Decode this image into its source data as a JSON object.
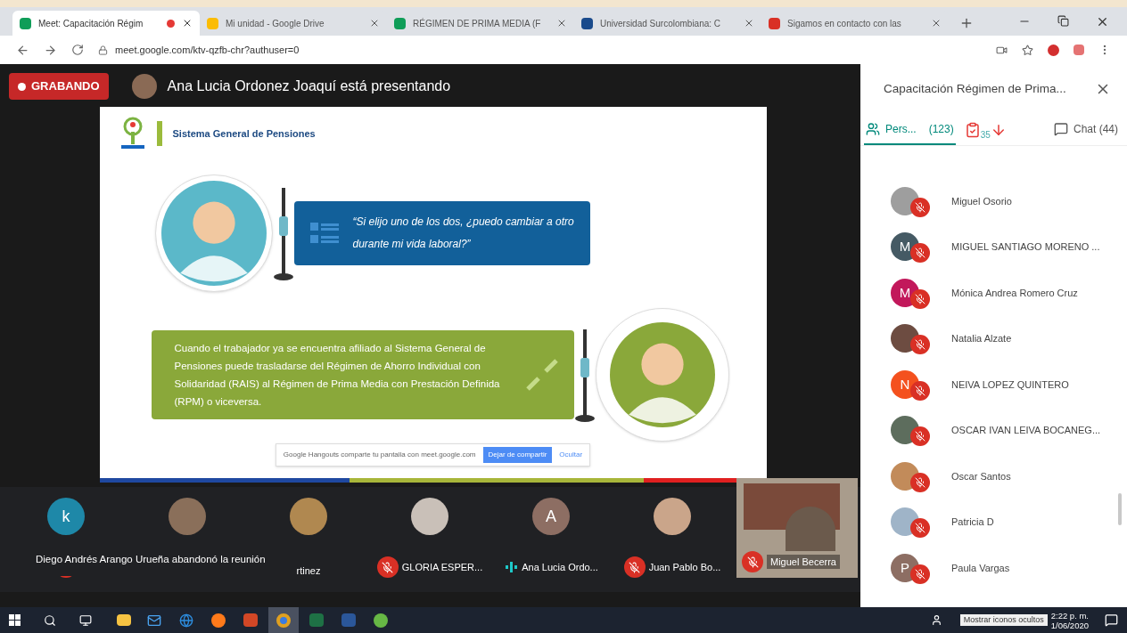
{
  "browser": {
    "tabs": [
      {
        "title": "Meet: Capacitación Régim",
        "selected": true,
        "color": "#0f9d58",
        "recording": true
      },
      {
        "title": "Mi unidad - Google Drive",
        "selected": false,
        "color": "#fbbc04",
        "recording": false
      },
      {
        "title": "RÉGIMEN DE PRIMA MEDIA (F",
        "selected": false,
        "color": "#0f9d58",
        "recording": false
      },
      {
        "title": "Universidad Surcolombiana: C",
        "selected": false,
        "color": "#1a4b8c",
        "recording": false
      },
      {
        "title": "Sigamos en contacto con las",
        "selected": false,
        "color": "#d93025",
        "recording": false
      }
    ],
    "address": "meet.google.com/ktv-qzfb-chr?authuser=0"
  },
  "meeting": {
    "recording_label": "GRABANDO",
    "presenter_text": "Ana Lucia Ordonez Joaquí está presentando"
  },
  "slide": {
    "title": "Sistema General de Pensiones",
    "question": "“Si elijo uno de los dos, ¿puedo cambiar a  otro durante mi vida laboral?”",
    "answer": "Cuando el trabajador ya se encuentra afiliado al Sistema General de Pensiones puede trasladarse del Régimen de Ahorro Individual con Solidaridad (RAIS) al Régimen de Prima Media con Prestación Definida (RPM) o viceversa.",
    "share_bar": {
      "text": "Google Hangouts comparte tu pantalla con meet.google.com",
      "stop_button": "Dejar de compartir",
      "hide_link": "Ocultar"
    }
  },
  "strip": {
    "toast": "Diego Andrés Arango Urueña abandonó la reunión",
    "tiles": [
      {
        "kind": "letter",
        "initial": "k",
        "color": "#1e88a8",
        "muted": true,
        "speaking": false
      },
      {
        "kind": "photo",
        "color": "#8a6f5a",
        "muted": false,
        "speaking": false
      },
      {
        "kind": "photo",
        "color": "#b08850",
        "name": "rtinez",
        "muted": false,
        "speaking": false
      },
      {
        "kind": "photo",
        "color": "#c9c0b8",
        "name": "GLORIA ESPER...",
        "muted": true,
        "speaking": false
      },
      {
        "kind": "letter",
        "initial": "A",
        "color": "#8d6e63",
        "name": "Ana Lucia Ordo...",
        "muted": false,
        "speaking": true
      },
      {
        "kind": "photo",
        "color": "#caa58a",
        "name": "Juan Pablo Bo...",
        "muted": true,
        "speaking": false
      },
      {
        "kind": "video",
        "color": "#6b5a4c",
        "name": "Miguel Becerra",
        "muted": true,
        "speaking": false
      }
    ]
  },
  "panel": {
    "title": "Capacitación Régimen de Prima...",
    "tabs": [
      {
        "kind": "people",
        "label": "Pers...",
        "count": "(123)",
        "selected": true
      },
      {
        "kind": "chat",
        "label": "Chat (44)",
        "selected": false
      }
    ],
    "hand_count": "35",
    "participants": [
      {
        "name": "Miguel Osorio",
        "kind": "photo",
        "color": "#9e9e9e",
        "muted": true
      },
      {
        "name": "MIGUEL SANTIAGO MORENO ...",
        "kind": "letter",
        "initial": "M",
        "color": "#455a64",
        "muted": true
      },
      {
        "name": "Mónica Andrea Romero Cruz",
        "kind": "letter",
        "initial": "M",
        "color": "#c2185b",
        "muted": true
      },
      {
        "name": "Natalia Alzate",
        "kind": "photo",
        "color": "#6d4c41",
        "muted": true
      },
      {
        "name": "NEIVA LOPEZ QUINTERO",
        "kind": "letter",
        "initial": "N",
        "color": "#f4511e",
        "muted": true
      },
      {
        "name": "OSCAR IVAN LEIVA BOCANEG...",
        "kind": "photo",
        "color": "#5d6d5d",
        "muted": true
      },
      {
        "name": "Oscar Santos",
        "kind": "photo",
        "color": "#c28b5a",
        "muted": true
      },
      {
        "name": "Patricia D",
        "kind": "photo",
        "color": "#9fb4c8",
        "muted": true
      },
      {
        "name": "Paula Vargas",
        "kind": "letter",
        "initial": "P",
        "color": "#8d6e63",
        "muted": true
      }
    ]
  },
  "taskbar": {
    "time": "2:22 p. m.",
    "date": "1/06/2020",
    "tooltip": "Mostrar iconos ocultos"
  }
}
